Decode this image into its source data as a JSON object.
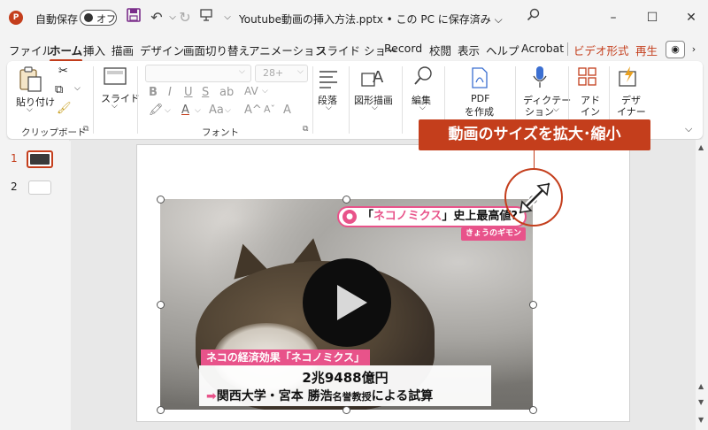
{
  "titlebar": {
    "app_icon": "P",
    "autosave_label": "自動保存",
    "autosave_state": "オフ",
    "doc_title": "Youtube動画の挿入方法.pptx • この PC に保存済み ⌵",
    "icons": [
      "save-icon",
      "undo-icon",
      "redo-icon",
      "present-icon",
      "customize-icon",
      "search-icon",
      "minimize-icon",
      "maximize-icon",
      "close-icon"
    ]
  },
  "tabs": [
    {
      "label": "ファイル"
    },
    {
      "label": "ホーム"
    },
    {
      "label": "挿入"
    },
    {
      "label": "描画"
    },
    {
      "label": "デザイン"
    },
    {
      "label": "画面切り替え"
    },
    {
      "label": "アニメーション"
    },
    {
      "label": "スライド ショー"
    },
    {
      "label": "Record"
    },
    {
      "label": "校閲"
    },
    {
      "label": "表示"
    },
    {
      "label": "ヘルプ"
    },
    {
      "label": "Acrobat"
    },
    {
      "label": "ビデオ形式"
    },
    {
      "label": "再生"
    }
  ],
  "active_tab": "ホーム",
  "ribbon": {
    "paste_label": "貼り付け",
    "clipboard_group": "クリップボード",
    "slide_label": "スライド",
    "font_group": "フォント",
    "font_size_placeholder": "28+",
    "paragraph_label": "段落",
    "drawing_label": "図形描画",
    "editing_label": "編集",
    "pdf_line1": "PDF",
    "pdf_line2": "を作成",
    "dictate_line1": "ディクテー",
    "dictate_line2": "ション",
    "addins_line1": "アド",
    "addins_line2": "イン",
    "designer_line1": "デザ",
    "designer_line2": "イナー"
  },
  "slides_pane": {
    "slide1_num": "1",
    "slide2_num": "2"
  },
  "video": {
    "caption_top_pre": "「",
    "caption_top_em": "ネコノミクス",
    "caption_top_post": "」史上最高値?",
    "caption_sub": "きょうのギモン",
    "caption_econ": "ネコの経済効果「ネコノミクス」",
    "caption_value": "2兆9488億円",
    "caption_source_arrow": "➡",
    "caption_source_main": "関西大学・宮本 勝浩",
    "caption_source_small": "名誉教授",
    "caption_source_end": "による試算"
  },
  "annotation": {
    "callout_text": "動画のサイズを拡大･縮小",
    "color": "#c43e1c"
  },
  "colors": {
    "accent": "#c43e1c",
    "caption_pink": "#e8538a"
  }
}
